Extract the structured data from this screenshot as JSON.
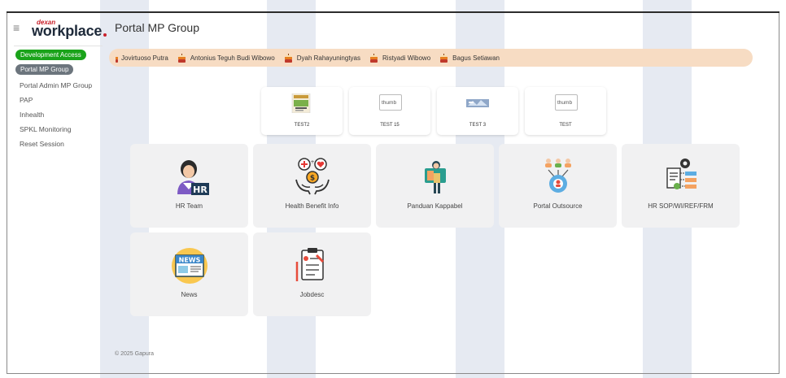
{
  "sidebar": {
    "logo_sub": "dexan",
    "logo_main": "workplace",
    "dev_badge": "Development Access",
    "active_item": "Portal MP Group",
    "items": [
      {
        "label": "Portal Admin MP Group"
      },
      {
        "label": "PAP"
      },
      {
        "label": "Inhealth"
      },
      {
        "label": "SPKL Monitoring"
      },
      {
        "label": "Reset Session"
      }
    ]
  },
  "page": {
    "title": "Portal MP Group",
    "footer": "© 2025 Gapura"
  },
  "birthdays": [
    "Jovirtuoso Putra",
    "Antonius Teguh Budi Wibowo",
    "Dyah Rahayuningtyas",
    "Ristyadi Wibowo",
    "Bagus Setiawan"
  ],
  "thumbs": [
    {
      "label": "TEST2",
      "alt": ""
    },
    {
      "label": "TEST 15",
      "alt": "thumb"
    },
    {
      "label": "TEST 3",
      "alt": ""
    },
    {
      "label": "TEST",
      "alt": "thumb"
    }
  ],
  "tiles": [
    {
      "label": "HR Team",
      "icon": "hr-team-icon"
    },
    {
      "label": "Health Benefit Info",
      "icon": "health-benefit-icon"
    },
    {
      "label": "Panduan Kappabel",
      "icon": "panduan-icon"
    },
    {
      "label": "Portal Outsource",
      "icon": "outsource-icon"
    },
    {
      "label": "HR SOP/WI/REF/FRM",
      "icon": "sop-icon"
    },
    {
      "label": "News",
      "icon": "news-icon"
    },
    {
      "label": "Jobdesc",
      "icon": "jobdesc-icon"
    }
  ],
  "colors": {
    "dev_badge": "#1aa31a",
    "ticker_bg": "#f7dcc3",
    "tile_bg": "#f1f1f2",
    "brand_red": "#c8202a"
  }
}
